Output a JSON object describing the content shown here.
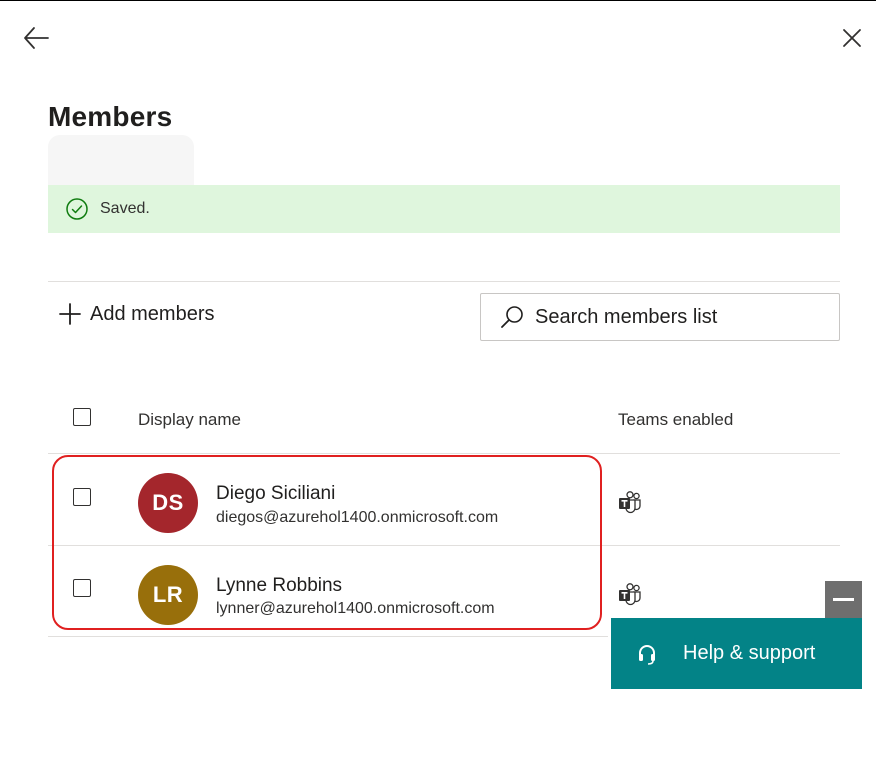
{
  "panel": {
    "title": "Members"
  },
  "banner": {
    "message": "Saved."
  },
  "toolbar": {
    "add_label": "Add members",
    "search_placeholder": "Search members list"
  },
  "table": {
    "columns": [
      "Display name",
      "Teams enabled"
    ],
    "rows": [
      {
        "initials": "DS",
        "name": "Diego Siciliani",
        "email": "diegos@azurehol1400.onmicrosoft.com",
        "avatar_color": "#a4262c",
        "teams_enabled": true
      },
      {
        "initials": "LR",
        "name": "Lynne Robbins",
        "email": "lynner@azurehol1400.onmicrosoft.com",
        "avatar_color": "#986f0b",
        "teams_enabled": true
      }
    ]
  },
  "help": {
    "label": "Help & support"
  },
  "colors": {
    "accent_teal": "#038387",
    "success_bg": "#dff6dd",
    "success_icon": "#107c10",
    "highlight_red": "#e02020"
  },
  "icons": {
    "back": "arrow-left-icon",
    "close": "close-icon",
    "success": "check-circle-icon",
    "add": "plus-icon",
    "search": "search-icon",
    "teams": "teams-icon",
    "help": "headset-icon",
    "minimize": "minimize-icon"
  }
}
